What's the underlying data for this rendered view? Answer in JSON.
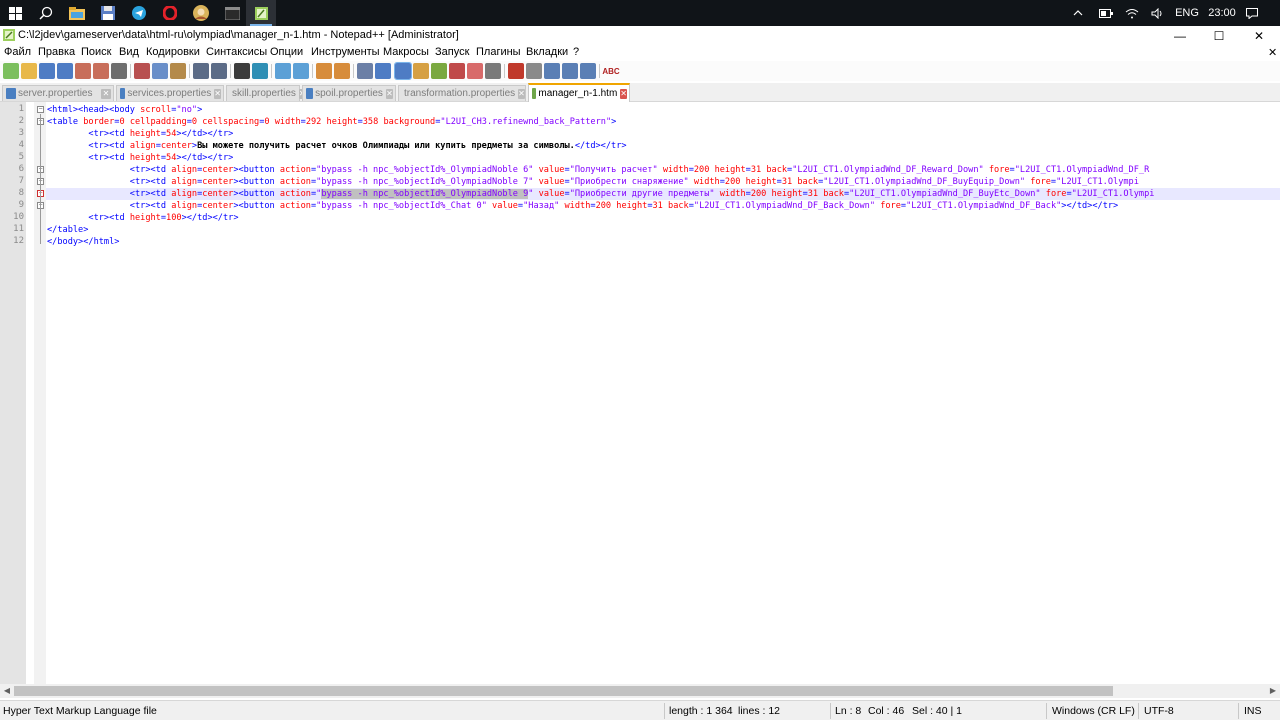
{
  "taskbar": {
    "icons": [
      "windows-icon",
      "search-icon",
      "file-explorer-icon",
      "save-floppy-icon",
      "telegram-icon",
      "opera-icon",
      "avatar-app-icon",
      "terminal-icon",
      "notepadpp-icon"
    ],
    "tray": {
      "language": "ENG",
      "time": "23:00"
    }
  },
  "window": {
    "title": "C:\\l2jdev\\gameserver\\data\\html-ru\\olympiad\\manager_n-1.htm - Notepad++ [Administrator]",
    "controls": {
      "minimize": "—",
      "maximize": "☐",
      "close": "✕"
    }
  },
  "menu": [
    "Файл",
    "Правка",
    "Поиск",
    "Вид",
    "Кодировки",
    "Синтаксисы",
    "Опции",
    "Инструменты",
    "Макросы",
    "Запуск",
    "Плагины",
    "Вкладки",
    "?"
  ],
  "menu_close": "✕",
  "toolbar": {
    "spell_label": "ABC"
  },
  "tabs": [
    {
      "label": "server.properties",
      "active": false
    },
    {
      "label": "services.properties",
      "active": false
    },
    {
      "label": "skill.properties",
      "active": false
    },
    {
      "label": "spoil.properties",
      "active": false
    },
    {
      "label": "transformation.properties",
      "active": false
    },
    {
      "label": "manager_n-1.htm",
      "active": true
    }
  ],
  "editor": {
    "line_numbers": [
      "1",
      "2",
      "3",
      "4",
      "5",
      "6",
      "7",
      "8",
      "9",
      "10",
      "11",
      "12"
    ],
    "current_line": 8
  },
  "status": {
    "file_type": "Hyper Text Markup Language file",
    "length": "length : 1 364",
    "lines": "lines : 12",
    "ln": "Ln : 8",
    "col": "Col : 46",
    "sel": "Sel : 40 | 1",
    "eol": "Windows (CR LF)",
    "encoding": "UTF-8",
    "mode": "INS"
  },
  "colors": {
    "tag": "#0000ff",
    "attribute": "#ff0000",
    "value": "#8000ff",
    "active_tab_accent": "#f0a500"
  }
}
